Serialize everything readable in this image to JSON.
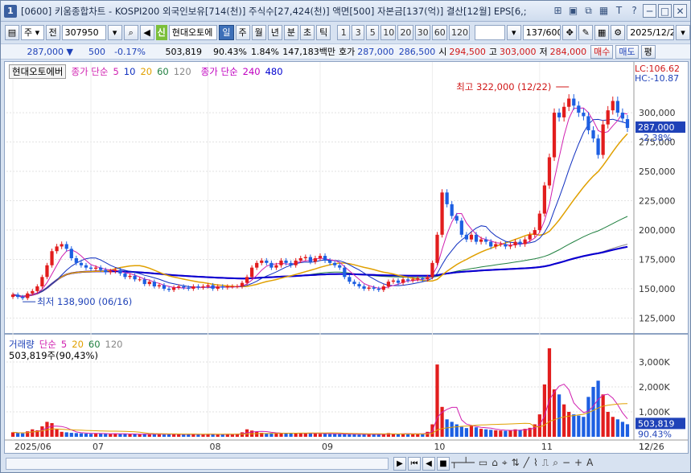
{
  "title": {
    "window_num": "1",
    "text": "[0600] 키움종합차트 - KOSPI200 외국인보유[714(천)] 주식수[27,424(천)] 액면[500] 자본금[137(억)] 결산[12월] EPS[6,;"
  },
  "title_buttons": [
    "⊞",
    "▣",
    "⧉",
    "▦",
    "T",
    "?",
    "─",
    "□"
  ],
  "toolbar": {
    "period_select": "주",
    "prev_label": "전",
    "code": "307950",
    "stock_name": "현대오토에",
    "shin_badge": "신",
    "periods": [
      "일",
      "주",
      "월",
      "년",
      "분",
      "초",
      "틱"
    ],
    "numbers": [
      "1",
      "3",
      "5",
      "10",
      "20",
      "30",
      "60",
      "120"
    ],
    "count": "137",
    "count_total": "/600",
    "date": "2025/12/26"
  },
  "info": {
    "price": "287,000",
    "arrow": "▼",
    "change": "500",
    "change_pct": "-0.17%",
    "volume": "503,819",
    "vol_pct": "90.43%",
    "turnover": "1.84%",
    "amount": "147,183백만",
    "ask_label": "호가",
    "ask": "287,000",
    "bid": "286,500",
    "open_label": "시",
    "open": "294,500",
    "high_label": "고",
    "high": "303,000",
    "low_label": "저",
    "low": "284,000",
    "buy_label": "매수",
    "sell_label": "매도",
    "eval_label": "평"
  },
  "price_legend": {
    "stock_name": "현대오토에버",
    "ma_label": "종가 단순",
    "ma_periods": [
      "5",
      "10",
      "20",
      "60",
      "120"
    ],
    "ma_colors": [
      "#d020b0",
      "#1030c0",
      "#e0a000",
      "#208040",
      "#888888"
    ],
    "ma2_label": "종가 단순",
    "ma2_periods": [
      "240",
      "480"
    ],
    "ma2_colors": [
      "#c000c0",
      "#0000d0"
    ]
  },
  "volume_legend": {
    "label": "거래량",
    "ma_label": "단순",
    "periods": [
      "5",
      "20",
      "60",
      "120"
    ],
    "colors": [
      "#d020b0",
      "#e0a000",
      "#208040",
      "#888888"
    ],
    "value_text": "503,819주(90,43%)"
  },
  "right_info": {
    "lc": "LC:106.62",
    "hc": "HC:-10.87",
    "price_tag": "287,000",
    "pct_tag": "-2.38%",
    "vol_tag": "503,819",
    "vol_pct_tag": "90.43%"
  },
  "annotations": {
    "high_text": "최고 322,000 (12/22)",
    "low_text": "최저 138,900 (06/16)"
  },
  "chart_data": {
    "type": "candlestick",
    "price_axis_ticks": [
      300000,
      275000,
      250000,
      225000,
      200000,
      175000,
      150000,
      125000
    ],
    "price_axis_labels": [
      "300,000",
      "275,000",
      "250,000",
      "225,000",
      "200,000",
      "175,000",
      "150,000",
      "125,000"
    ],
    "price_range": [
      115000,
      335000
    ],
    "volume_axis_ticks": [
      3000,
      2000,
      1000
    ],
    "volume_axis_labels": [
      "3,000K",
      "2,000K",
      "1,000K"
    ],
    "volume_range": [
      0,
      4000
    ],
    "x_labels": [
      "2025/06",
      "07",
      "08",
      "09",
      "10",
      "11",
      "12",
      "12/26"
    ],
    "x_label_index": [
      0,
      16,
      40,
      63,
      86,
      108,
      130,
      157
    ],
    "closes": [
      145000,
      143000,
      142000,
      146000,
      148000,
      152000,
      160000,
      170000,
      182000,
      186000,
      188000,
      184000,
      176000,
      172000,
      170000,
      168000,
      167000,
      168000,
      166000,
      164000,
      165000,
      166000,
      163000,
      160000,
      161000,
      158000,
      158000,
      154000,
      156000,
      152000,
      153000,
      150000,
      149000,
      151000,
      152000,
      151000,
      150000,
      152000,
      151000,
      152000,
      153000,
      150000,
      152000,
      151000,
      152000,
      152000,
      152000,
      155000,
      160000,
      168000,
      172000,
      174000,
      172000,
      168000,
      170000,
      174000,
      172000,
      170000,
      174000,
      176000,
      177000,
      173000,
      176000,
      178000,
      174000,
      172000,
      170000,
      168000,
      160000,
      156000,
      154000,
      152000,
      150000,
      151000,
      150000,
      149000,
      152000,
      156000,
      157000,
      155000,
      158000,
      157000,
      158000,
      159000,
      158000,
      160000,
      172000,
      196000,
      232000,
      222000,
      212000,
      208000,
      196000,
      192000,
      196000,
      190000,
      192000,
      190000,
      186000,
      188000,
      188000,
      186000,
      187000,
      190000,
      188000,
      192000,
      196000,
      200000,
      214000,
      238000,
      262000,
      300000,
      296000,
      305000,
      312000,
      306000,
      300000,
      297000,
      285000,
      278000,
      264000,
      290000,
      302000,
      310000,
      300000,
      295000,
      287000
    ],
    "opens": [
      143000,
      145000,
      143000,
      142000,
      146000,
      148000,
      152000,
      160000,
      170000,
      182000,
      186000,
      188000,
      184000,
      176000,
      172000,
      170000,
      168000,
      167000,
      168000,
      166000,
      164000,
      165000,
      166000,
      163000,
      160000,
      161000,
      158000,
      158000,
      154000,
      156000,
      152000,
      153000,
      150000,
      149000,
      151000,
      152000,
      151000,
      150000,
      152000,
      151000,
      152000,
      153000,
      150000,
      152000,
      151000,
      152000,
      152000,
      152000,
      155000,
      160000,
      168000,
      172000,
      174000,
      172000,
      168000,
      170000,
      174000,
      172000,
      170000,
      174000,
      176000,
      177000,
      173000,
      176000,
      178000,
      174000,
      172000,
      170000,
      168000,
      160000,
      156000,
      154000,
      152000,
      150000,
      151000,
      150000,
      149000,
      152000,
      156000,
      157000,
      155000,
      158000,
      157000,
      158000,
      159000,
      158000,
      160000,
      172000,
      196000,
      232000,
      222000,
      212000,
      208000,
      196000,
      192000,
      196000,
      190000,
      192000,
      190000,
      186000,
      188000,
      188000,
      186000,
      187000,
      190000,
      188000,
      192000,
      196000,
      200000,
      214000,
      238000,
      262000,
      300000,
      296000,
      305000,
      312000,
      306000,
      300000,
      297000,
      285000,
      278000,
      264000,
      290000,
      302000,
      310000,
      300000,
      294500
    ],
    "volumes": [
      180,
      150,
      140,
      220,
      300,
      260,
      420,
      600,
      550,
      300,
      200,
      180,
      160,
      150,
      140,
      130,
      120,
      140,
      130,
      120,
      110,
      130,
      110,
      120,
      100,
      110,
      100,
      120,
      110,
      100,
      110,
      90,
      100,
      110,
      100,
      90,
      100,
      110,
      100,
      90,
      110,
      100,
      90,
      100,
      110,
      100,
      120,
      180,
      300,
      250,
      200,
      160,
      140,
      150,
      160,
      140,
      130,
      150,
      140,
      150,
      130,
      140,
      130,
      120,
      130,
      110,
      120,
      110,
      100,
      110,
      100,
      90,
      100,
      110,
      100,
      90,
      100,
      150,
      120,
      110,
      130,
      120,
      110,
      120,
      130,
      200,
      500,
      2900,
      1200,
      700,
      600,
      500,
      400,
      350,
      450,
      380,
      320,
      300,
      280,
      260,
      250,
      240,
      260,
      300,
      280,
      320,
      360,
      500,
      900,
      2100,
      3550,
      1900,
      1700,
      1300,
      1000,
      900,
      850,
      800,
      1600,
      2000,
      2250,
      1700,
      1000,
      800,
      700,
      600,
      503.819
    ]
  }
}
